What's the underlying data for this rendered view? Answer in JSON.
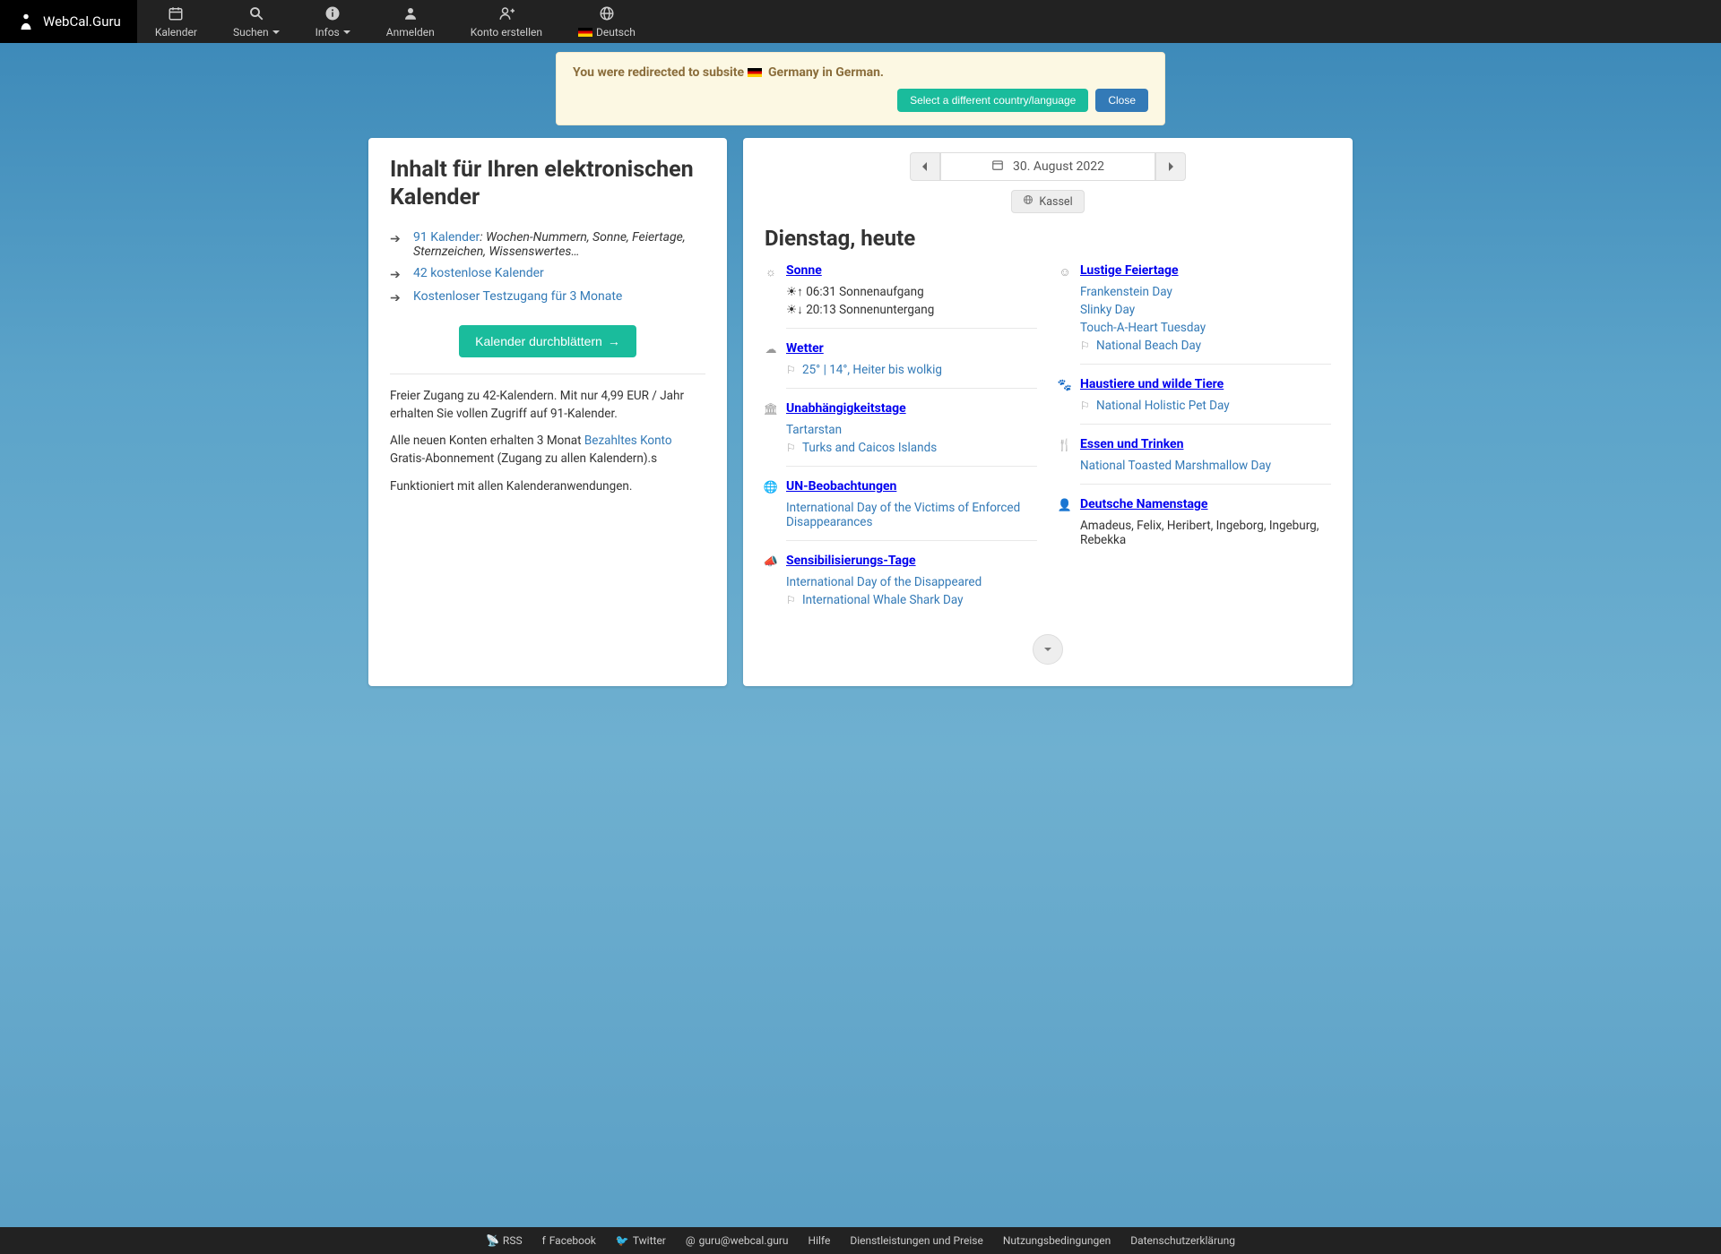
{
  "brand": "WebCal.Guru",
  "nav": {
    "kalender": "Kalender",
    "suchen": "Suchen",
    "infos": "Infos",
    "anmelden": "Anmelden",
    "konto": "Konto erstellen",
    "deutsch": "Deutsch"
  },
  "alert": {
    "text_pre": "You were redirected to subsite ",
    "text_post": " Germany in German.",
    "select_btn": "Select a different country/language",
    "close_btn": "Close"
  },
  "left": {
    "title": "Inhalt für Ihren elektronischen Kalender",
    "link1": "91 Kalender",
    "link1_suffix": ": Wochen-Nummern, Sonne, Feiertage, Sternzeichen, Wissenswertes…",
    "link2": "42 kostenlose Kalender",
    "link3": "Kostenloser Testzugang für 3 Monate",
    "browse_btn": "Kalender durchblättern",
    "p1": "Freier Zugang zu 42-Kalendern. Mit nur 4,99 EUR / Jahr erhalten Sie vollen Zugriff auf 91-Kalender.",
    "p2_pre": "Alle neuen Konten erhalten 3 Monat ",
    "p2_link": "Bezahltes Konto",
    "p2_post": " Gratis-Abonnement (Zugang zu allen Kalendern).s",
    "p3": "Funktioniert mit allen Kalenderanwendungen."
  },
  "right": {
    "date": "30. August 2022",
    "location": "Kassel",
    "heading": "Dienstag, heute",
    "sonne": {
      "title": "Sonne",
      "sunrise": "☀↑  06:31 Sonnenaufgang",
      "sunset": "☀↓  20:13 Sonnenuntergang"
    },
    "wetter": {
      "title": "Wetter",
      "line": "25° | 14°, Heiter bis wolkig"
    },
    "unabh": {
      "title": "Unabhängigkeitstage",
      "l1": "Tartarstan",
      "l2": "Turks and Caicos Islands"
    },
    "un": {
      "title": "UN-Beobachtungen",
      "l1": "International Day of the Victims of Enforced Disappearances"
    },
    "sens": {
      "title": "Sensibilisierungs-Tage",
      "l1": "International Day of the Disappeared",
      "l2": "International Whale Shark Day"
    },
    "lustige": {
      "title": "Lustige Feiertage",
      "l1": "Frankenstein Day",
      "l2": "Slinky Day",
      "l3": "Touch-A-Heart Tuesday",
      "l4": "National Beach Day"
    },
    "haustiere": {
      "title": "Haustiere und wilde Tiere",
      "l1": "National Holistic Pet Day"
    },
    "essen": {
      "title": "Essen und Trinken",
      "l1": "National Toasted Marshmallow Day"
    },
    "namenstage": {
      "title": "Deutsche Namenstage",
      "l1": "Amadeus, Felix, Heribert, Ingeborg, Ingeburg, Rebekka"
    }
  },
  "footer": {
    "rss": "RSS",
    "facebook": "Facebook",
    "twitter": "Twitter",
    "email": "guru@webcal.guru",
    "hilfe": "Hilfe",
    "dienst": "Dienstleistungen und Preise",
    "nutzung": "Nutzungsbedingungen",
    "datenschutz": "Datenschutzerklärung"
  }
}
